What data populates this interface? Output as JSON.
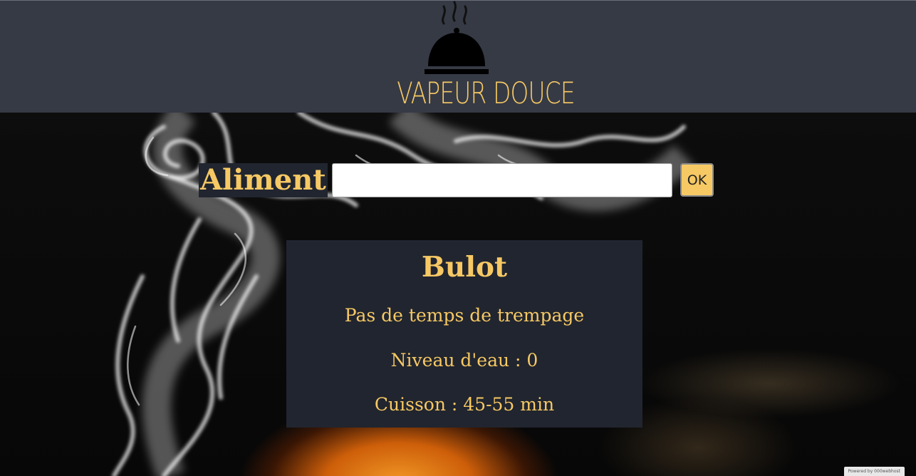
{
  "header": {
    "logo_text": "VAPEUR DOUCE",
    "logo_icon": "steaming-cloche-icon",
    "background_color": "#363a45",
    "accent_color": "#f7c964"
  },
  "search": {
    "label": "Aliment",
    "value": "",
    "placeholder": "",
    "button_label": "OK"
  },
  "result": {
    "title": "Bulot",
    "soak_text": "Pas de temps de trempage",
    "water_level_text": "Niveau d'eau : 0",
    "cooking_text": "Cuisson : 45-55 min",
    "card_color": "#21252f"
  },
  "footer": {
    "powered_text": "Powered by 000webhost"
  }
}
